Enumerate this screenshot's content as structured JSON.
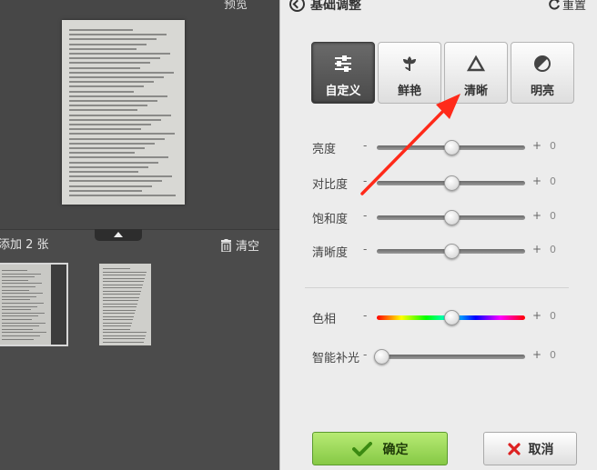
{
  "preview": {
    "toolbar_label": "预览"
  },
  "strip": {
    "added_label": "添加 2 张",
    "clear_label": "清空"
  },
  "panel": {
    "title": "基础调整",
    "reset_label": "重置",
    "modes": [
      {
        "label": "自定义",
        "icon": "sliders-icon",
        "active": true
      },
      {
        "label": "鲜艳",
        "icon": "flower-icon",
        "active": false
      },
      {
        "label": "清晰",
        "icon": "triangle-icon",
        "active": false
      },
      {
        "label": "明亮",
        "icon": "contrast-icon",
        "active": false
      }
    ],
    "sliders": [
      {
        "label": "亮度",
        "minus": "-",
        "plus": "+",
        "value": "0",
        "position": 0.5
      },
      {
        "label": "对比度",
        "minus": "-",
        "plus": "+",
        "value": "0",
        "position": 0.5
      },
      {
        "label": "饱和度",
        "minus": "-",
        "plus": "+",
        "value": "0",
        "position": 0.5
      },
      {
        "label": "清晰度",
        "minus": "-",
        "plus": "+",
        "value": "0",
        "position": 0.5
      },
      {
        "label": "色相",
        "minus": "-",
        "plus": "+",
        "value": "0",
        "position": 0.5
      },
      {
        "label": "智能补光",
        "minus": "-",
        "plus": "+",
        "value": "0",
        "position": 0
      }
    ],
    "confirm_label": "确定",
    "cancel_label": "取消"
  },
  "colors": {
    "accent_green": "#86c945",
    "annotation_red": "#ff2a1a",
    "active_mode": "#555555"
  }
}
